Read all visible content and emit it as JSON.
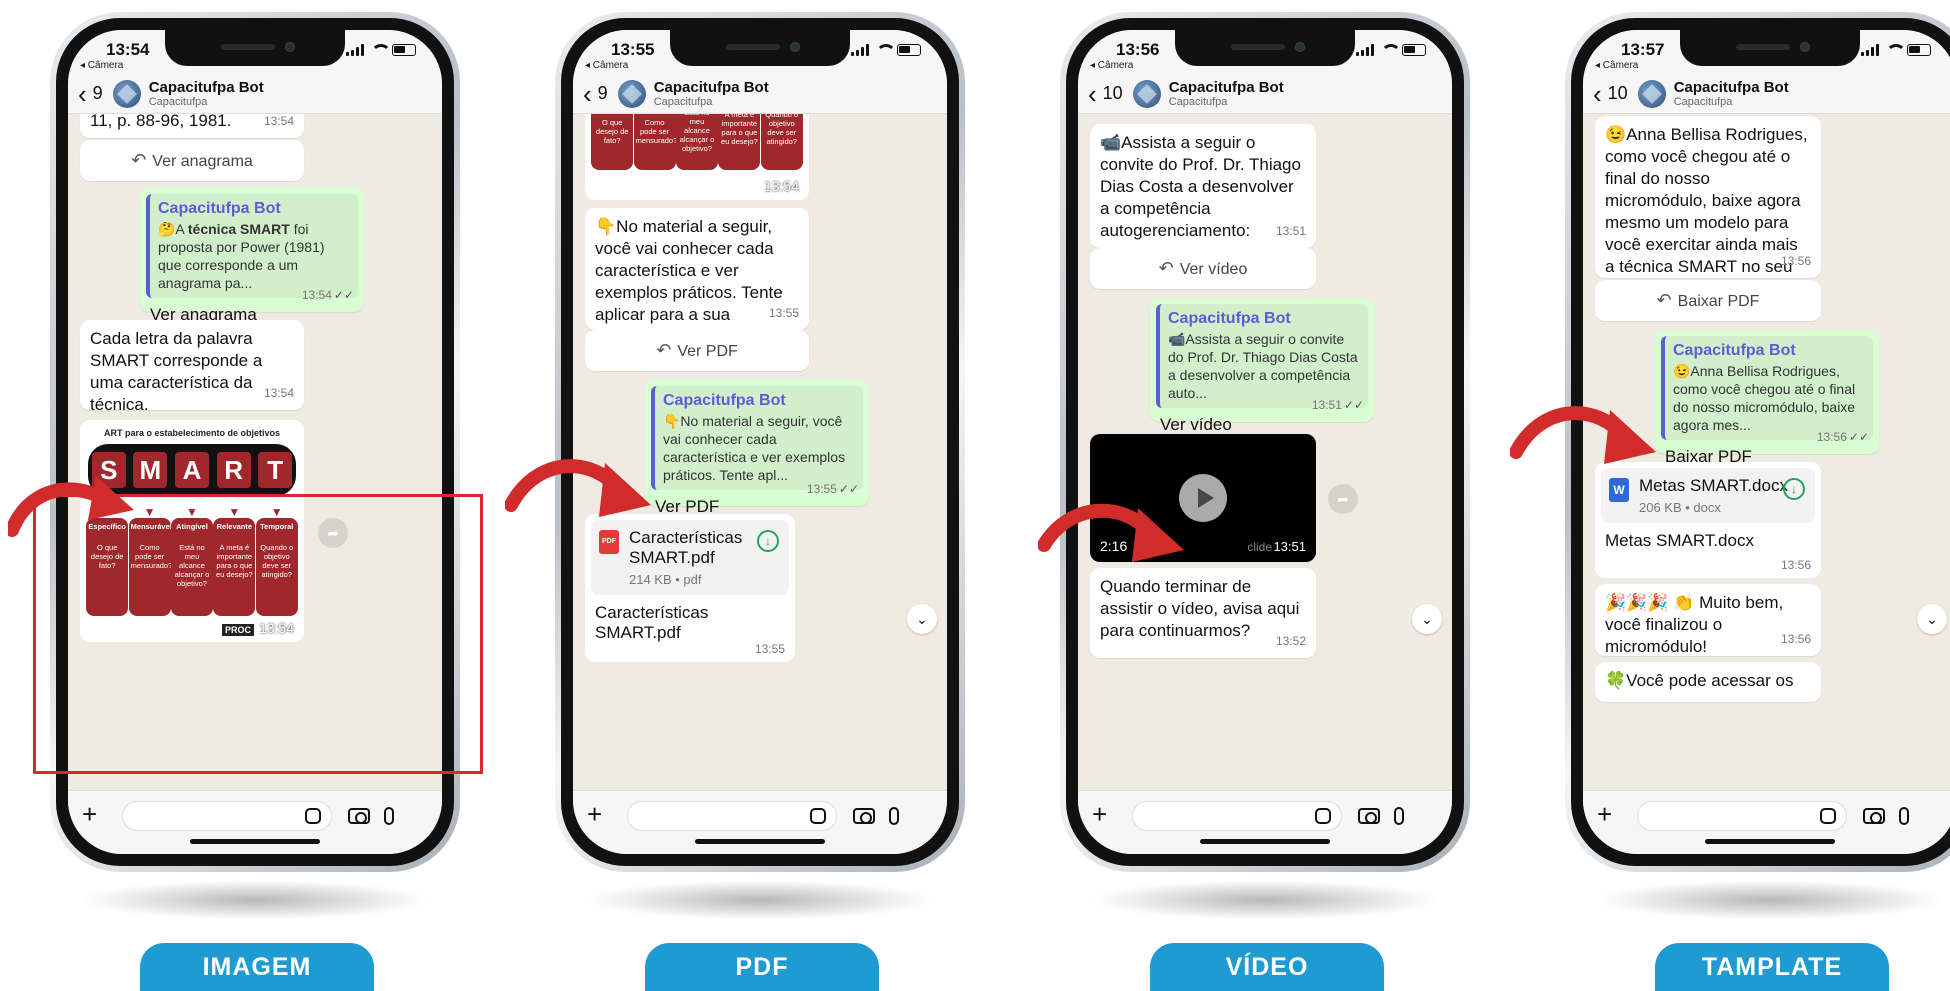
{
  "common": {
    "back_camera": "◂ Câmera",
    "contact_name": "Capacitufpa Bot",
    "contact_sub": "Capacitufpa",
    "ticks": "✓✓"
  },
  "phones": [
    {
      "time": "13:54",
      "unread": "9",
      "partial_top": "11, p. 88-96, 1981.",
      "partial_top_ts": "13:54",
      "btn1": "Ver anagrama",
      "quote_name": "Capacitufpa Bot",
      "quote_text_a": "🤔A ",
      "quote_text_b": "técnica SMART",
      "quote_text_c": " foi proposta por Power (1981) que corresponde a um anagrama pa...",
      "out_text": "Ver anagrama",
      "out_ts": "13:54",
      "in_text": "Cada letra da palavra SMART corresponde a uma característica da técnica.",
      "in_ts": "13:54",
      "smart_title": "ART para o estabelecimento de objetivos",
      "smart_letters": [
        "S",
        "M",
        "A",
        "R",
        "T"
      ],
      "smart_cols": [
        {
          "title": "Específico",
          "text": "O que desejo de fato?"
        },
        {
          "title": "Mensurável",
          "text": "Como pode ser mensurado?"
        },
        {
          "title": "Atingível",
          "text": "Está no meu alcance alcançar o objetivo?"
        },
        {
          "title": "Relevante",
          "text": "A meta é importante para o que eu desejo?"
        },
        {
          "title": "Temporal",
          "text": "Quando o objetivo deve ser atingido?"
        }
      ],
      "smart_logo": "PROC",
      "img_ts": "13:54"
    },
    {
      "time": "13:55",
      "unread": "9",
      "img_top_cols": [
        "O que desejo de fato?",
        "Como pode ser mensurado?",
        "Está no meu alcance alcançar o objetivo?",
        "A meta é importante para o que eu desejo?",
        "Quando o objetivo deve ser atingido?"
      ],
      "img_ts": "13:54",
      "in_text": "👇No material a seguir, você vai conhecer cada característica e ver exemplos práticos. Tente aplicar para a sua realidade.",
      "in_ts": "13:55",
      "btn1": "Ver PDF",
      "quote_name": "Capacitufpa Bot",
      "quote_text": "👇No material a seguir, você vai conhecer cada característica e ver exemplos práticos. Tente apl...",
      "out_text": "Ver PDF",
      "out_ts": "13:55",
      "file_icon": "PDF",
      "file_name": "Características SMART.pdf",
      "file_meta": "214 KB • pdf",
      "file_caption": "Características SMART.pdf",
      "file_ts": "13:55"
    },
    {
      "time": "13:56",
      "unread": "10",
      "in_text": "📹Assista a seguir o convite do Prof. Dr. Thiago Dias Costa a desenvolver a competência autogerenciamento:",
      "in_ts": "13:51",
      "btn1": "Ver vídeo",
      "quote_name": "Capacitufpa Bot",
      "quote_text": "📹Assista a seguir o convite do Prof. Dr. Thiago Dias Costa a desenvolver a competência auto...",
      "out_text": "Ver vídeo",
      "out_ts": "13:51",
      "video_duration": "2:16",
      "video_wm": "clide",
      "video_ts": "13:51",
      "in2_text": "Quando terminar de assistir o vídeo, avisa aqui para continuarmos?",
      "in2_ts": "13:52"
    },
    {
      "time": "13:57",
      "unread": "10",
      "in_text": "😉Anna Bellisa Rodrigues, como você chegou até o final do nosso micromódulo, baixe agora mesmo um modelo para você exercitar ainda mais a técnica SMART no seu dia a dia.",
      "in_ts": "13:56",
      "btn1": "Baixar PDF",
      "quote_name": "Capacitufpa Bot",
      "quote_text": "😉Anna Bellisa Rodrigues, como você chegou até o final do nosso micromódulo, baixe agora mes...",
      "out_text": "Baixar PDF",
      "out_ts": "13:56",
      "file_icon": "W",
      "file_name": "Metas SMART.docx",
      "file_meta": "206 KB • docx",
      "file_caption": "Metas SMART.docx",
      "file_ts": "13:56",
      "in2_text": "🎉🎉🎉 👏 Muito bem, você finalizou o micromódulo!",
      "in2_ts": "13:56",
      "in3_text": "🍀Você pode acessar os"
    }
  ],
  "labels": [
    "IMAGEM",
    "PDF",
    "VÍDEO",
    "TAMPLATE"
  ],
  "colors": {
    "label_bg": "#1f9bd1",
    "arrow": "#d22b2b",
    "smart_red": "#a0282d",
    "out_bubble": "#d9fdd3",
    "quote_accent": "#5b5fd6"
  }
}
